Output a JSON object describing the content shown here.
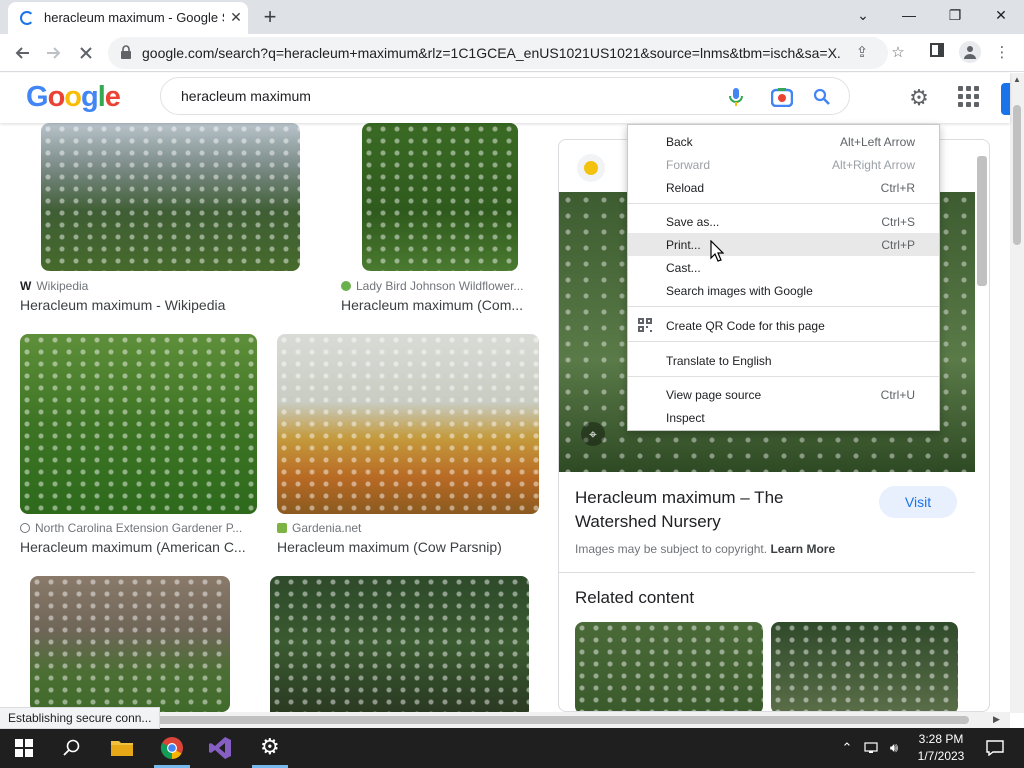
{
  "browser": {
    "tab_title": "heracleum maximum - Google Se",
    "tab_close": "✕",
    "new_tab": "+",
    "url": "google.com/search?q=heracleum+maximum&rlz=1C1GCEA_enUS1021US1021&source=lnms&tbm=isch&sa=X...",
    "window_controls": {
      "collapse": "⌄",
      "minimize": "—",
      "restore": "❐",
      "close": "✕"
    }
  },
  "google": {
    "logo": [
      "G",
      "o",
      "o",
      "g",
      "l",
      "e"
    ],
    "logo_colors": [
      "#4285f4",
      "#ea4335",
      "#fbbc05",
      "#4285f4",
      "#34a853",
      "#ea4335"
    ],
    "query": "heracleum maximum"
  },
  "results": [
    {
      "source": "Wikipedia",
      "source_prefix": "W",
      "title": "Heracleum maximum - Wikipedia"
    },
    {
      "source": "Lady Bird Johnson Wildflower...",
      "title": "Heracleum maximum (Com..."
    },
    {
      "source": "North Carolina Extension Gardener P...",
      "title": "Heracleum maximum (American C..."
    },
    {
      "source": "Gardenia.net",
      "title": "Heracleum maximum (Cow Parsnip)"
    }
  ],
  "panel": {
    "title": "Heracleum maximum – The Watershed Nursery",
    "visit": "Visit",
    "copyright": "Images may be subject to copyright.",
    "learn_more": "Learn More",
    "related": "Related content"
  },
  "context_menu": {
    "items": [
      {
        "label": "Back",
        "shortcut": "Alt+Left Arrow"
      },
      {
        "label": "Forward",
        "shortcut": "Alt+Right Arrow"
      },
      {
        "label": "Reload",
        "shortcut": "Ctrl+R"
      },
      {
        "label": "Save as...",
        "shortcut": "Ctrl+S"
      },
      {
        "label": "Print...",
        "shortcut": "Ctrl+P"
      },
      {
        "label": "Cast..."
      },
      {
        "label": "Search images with Google"
      },
      {
        "label": "Create QR Code for this page"
      },
      {
        "label": "Translate to English"
      },
      {
        "label": "View page source",
        "shortcut": "Ctrl+U"
      },
      {
        "label": "Inspect"
      }
    ]
  },
  "status_bar": "Establishing secure conn...",
  "taskbar": {
    "time": "3:28 PM",
    "date": "1/7/2023"
  }
}
